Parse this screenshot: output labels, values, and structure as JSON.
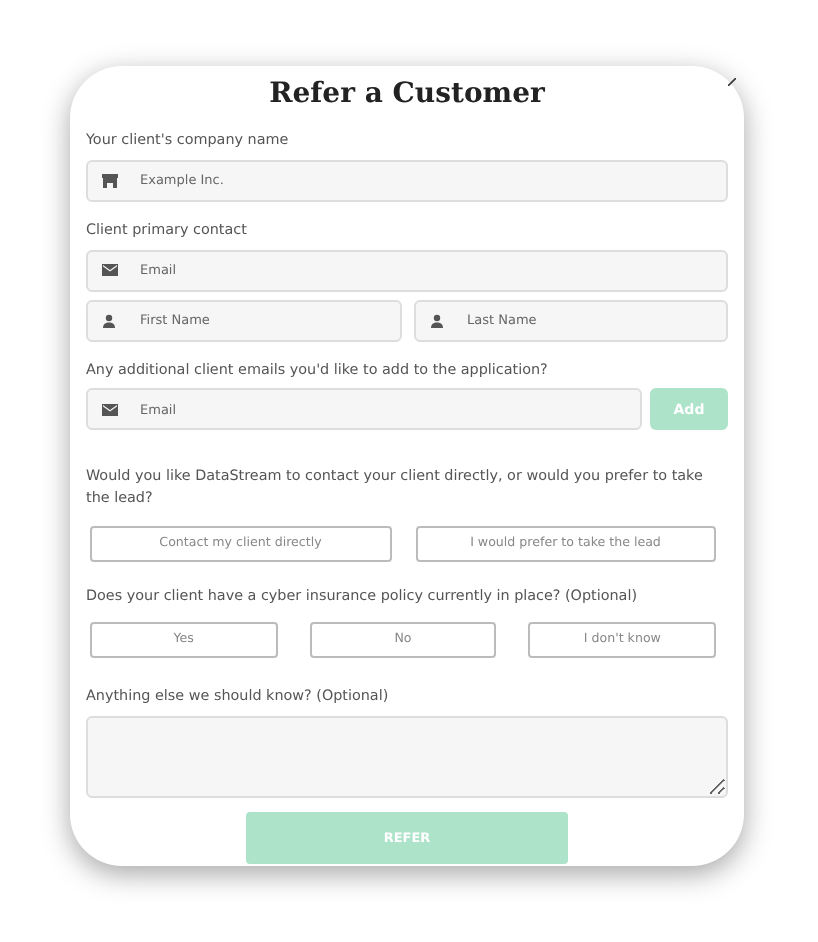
{
  "title": "Refer a Customer",
  "company": {
    "label": "Your client's company name",
    "field": {
      "kind": "store",
      "placeholder": "Example Inc."
    }
  },
  "contact": {
    "label": "Client primary contact",
    "email": {
      "kind": "mail",
      "placeholder": "Email"
    },
    "first_name": {
      "kind": "person",
      "placeholder": "First Name"
    },
    "last_name": {
      "kind": "person",
      "placeholder": "Last Name"
    }
  },
  "additional": {
    "label": "Any additional client emails you'd like to add to the application?",
    "field": {
      "kind": "mail",
      "placeholder": "Email"
    },
    "add_button": {
      "label": "Add",
      "disabled": true
    }
  },
  "contact_choice": {
    "question": "Would you like DataStream to contact your client directly, or would you prefer to take the lead?",
    "options": [
      {
        "label": "Contact my client directly",
        "selected": false
      },
      {
        "label": "I would prefer to take the lead",
        "selected": false
      }
    ]
  },
  "insurance": {
    "question": "Does your client have a cyber insurance policy currently in place? (Optional)",
    "options": [
      {
        "label": "Yes",
        "selected": false
      },
      {
        "label": "No",
        "selected": false
      },
      {
        "label": "I don't know",
        "selected": false
      }
    ]
  },
  "notes": {
    "label": "Anything else we should know? (Optional)"
  },
  "submit": {
    "label": "REFER",
    "disabled": true
  }
}
